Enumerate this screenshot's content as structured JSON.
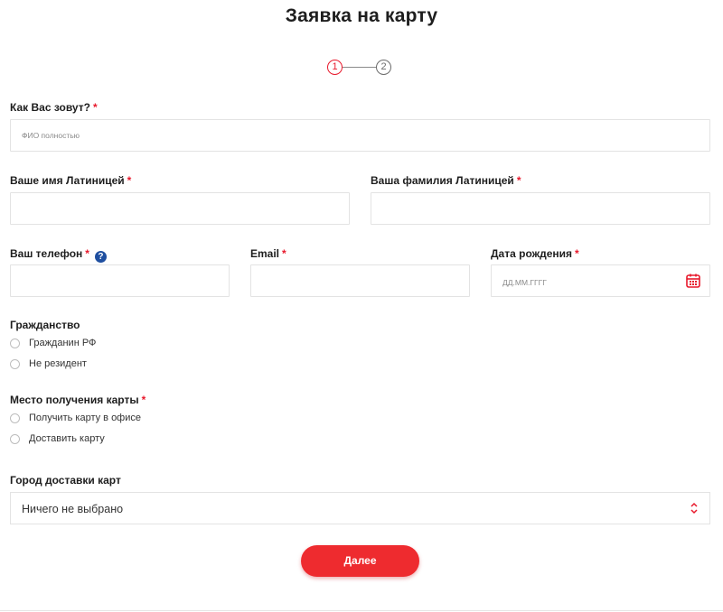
{
  "header": {
    "title": "Заявка на карту"
  },
  "steps": {
    "current": "1",
    "next": "2"
  },
  "fields": {
    "full_name": {
      "label": "Как Вас зовут?",
      "required_mark": "*",
      "placeholder": "ФИО полностью"
    },
    "first_name_latin": {
      "label": "Ваше имя Латиницей",
      "required_mark": "*"
    },
    "last_name_latin": {
      "label": "Ваша фамилия Латиницей",
      "required_mark": "*"
    },
    "phone": {
      "label": "Ваш телефон",
      "required_mark": "*",
      "help_glyph": "?"
    },
    "email": {
      "label": "Email",
      "required_mark": "*"
    },
    "birth_date": {
      "label": "Дата рождения",
      "required_mark": "*",
      "placeholder": "ДД.ММ.ГГГГ"
    }
  },
  "citizenship": {
    "label": "Гражданство",
    "options": [
      "Гражданин РФ",
      "Не резидент"
    ]
  },
  "card_pickup": {
    "label": "Место получения карты",
    "required_mark": "*",
    "options": [
      "Получить карту в офисе",
      "Доставить карту"
    ]
  },
  "delivery_city": {
    "label": "Город доставки карт",
    "selected": "Ничего не выбрано"
  },
  "actions": {
    "next_label": "Далее"
  },
  "colors": {
    "accent": "#e8192c",
    "button": "#ee2b2f",
    "help": "#1f4fa0",
    "border": "#e3e3e3"
  }
}
